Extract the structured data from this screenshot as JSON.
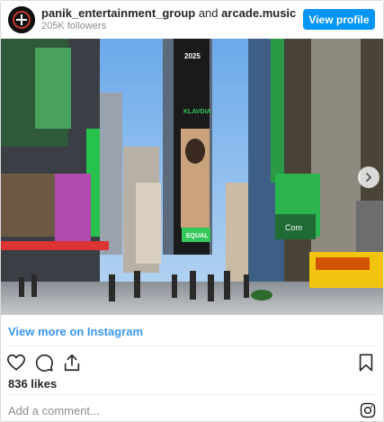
{
  "header": {
    "username": "panik_entertainment_group",
    "connector": "and",
    "collaborator": "arcade.music",
    "followers": "205K followers",
    "view_profile_label": "View profile"
  },
  "photo": {
    "billboard_year": "2025",
    "billboard_brand": "KLAVDIA",
    "billboard_tag": "EQUAL",
    "sign_com": "Com",
    "description_icon": "times-square-photo"
  },
  "view_more_label": "View more on Instagram",
  "actions": {
    "icons": [
      "heart-icon",
      "comment-icon",
      "share-icon",
      "bookmark-icon"
    ]
  },
  "likes": "836 likes",
  "comment_placeholder": "Add a comment...",
  "colors": {
    "accent": "#0095f6",
    "link": "#3897f0",
    "sky": "#7fb3e8"
  }
}
